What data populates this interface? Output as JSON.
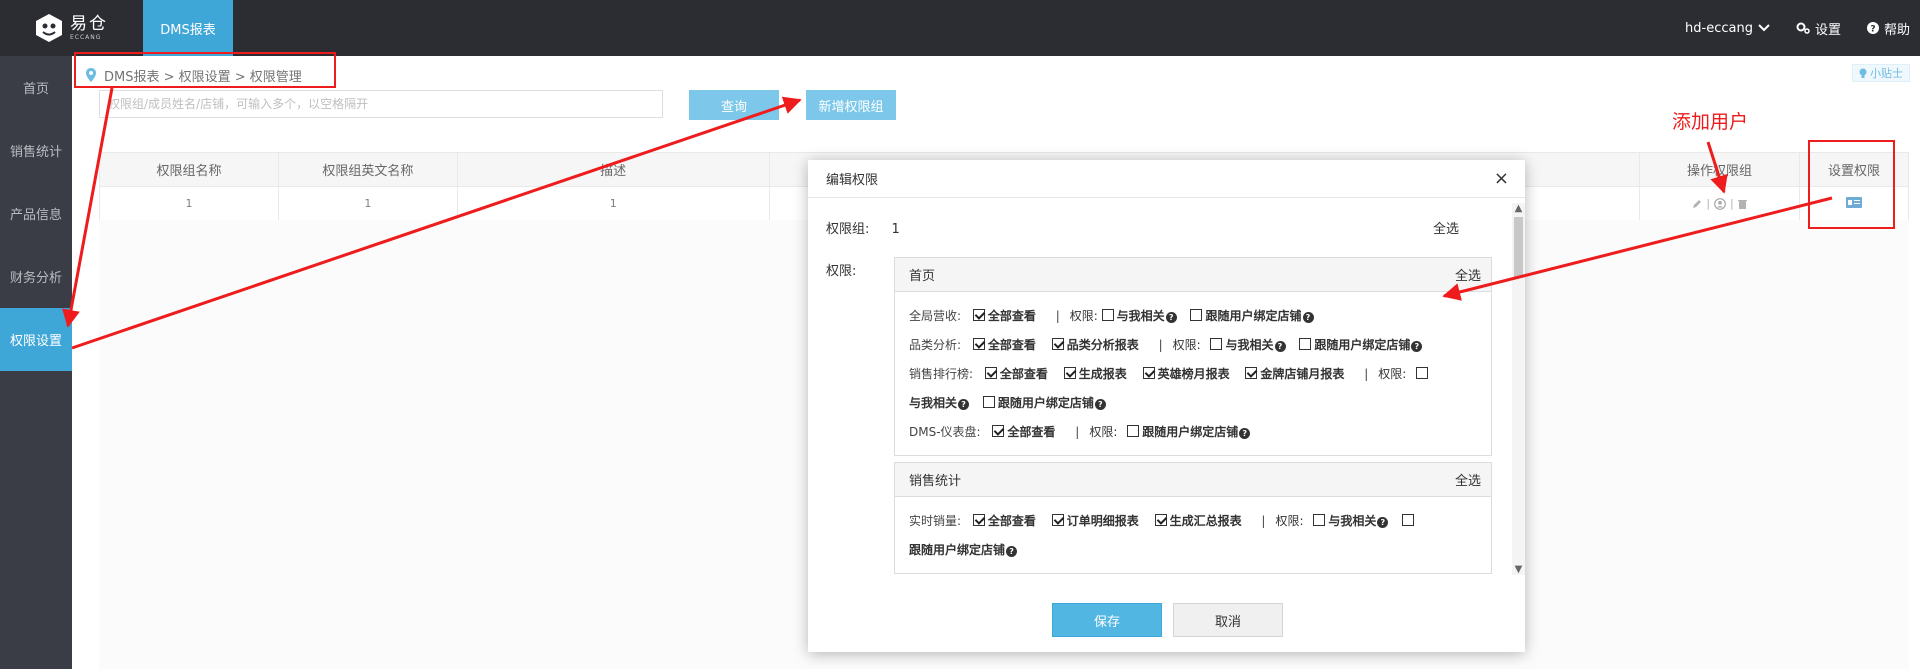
{
  "topbar": {
    "logo_cn": "易仓",
    "logo_en": "ECCANG",
    "active_tab": "DMS报表",
    "user": "hd-eccang",
    "settings": "设置",
    "help": "帮助"
  },
  "sidebar": {
    "items": [
      {
        "label": "首页"
      },
      {
        "label": "销售统计"
      },
      {
        "label": "产品信息"
      },
      {
        "label": "财务分析"
      },
      {
        "label": "权限设置"
      }
    ]
  },
  "breadcrumb": "DMS报表 > 权限设置 > 权限管理",
  "tips": "小贴士",
  "search": {
    "placeholder": "权限组/成员姓名/店铺，可输入多个，以空格隔开"
  },
  "buttons": {
    "query": "查询",
    "add_group": "新增权限组"
  },
  "table": {
    "headers": [
      "权限组名称",
      "权限组英文名称",
      "描述",
      "",
      "操作权限组",
      "设置权限"
    ],
    "row": [
      "1",
      "1",
      "1"
    ]
  },
  "modal": {
    "title": "编辑权限",
    "group_label": "权限组:",
    "group_value": "1",
    "select_all": "全选",
    "perm_label": "权限:",
    "save": "保存",
    "cancel": "取消",
    "panel_home": {
      "title": "首页",
      "select_all": "全选",
      "row1_label": "全局营收:",
      "row2_label": "品类分析:",
      "row3_label": "销售排行榜:",
      "row4_label": "DMS-仪表盘:",
      "view_all": "全部查看",
      "category_report": "品类分析报表",
      "generate_report": "生成报表",
      "hero_report": "英雄榜月报表",
      "gold_report": "金牌店铺月报表",
      "perm": "权限:",
      "related_to_me": "与我相关",
      "follow_store": "跟随用户绑定店铺"
    },
    "panel_sales": {
      "title": "销售统计",
      "select_all": "全选",
      "row1_label": "实时销量:",
      "view_all": "全部查看",
      "order_detail": "订单明细报表",
      "summary_report": "生成汇总报表",
      "perm": "权限:",
      "related_to_me": "与我相关",
      "follow_store": "跟随用户绑定店铺"
    }
  },
  "annotation": {
    "add_user": "添加用户"
  }
}
